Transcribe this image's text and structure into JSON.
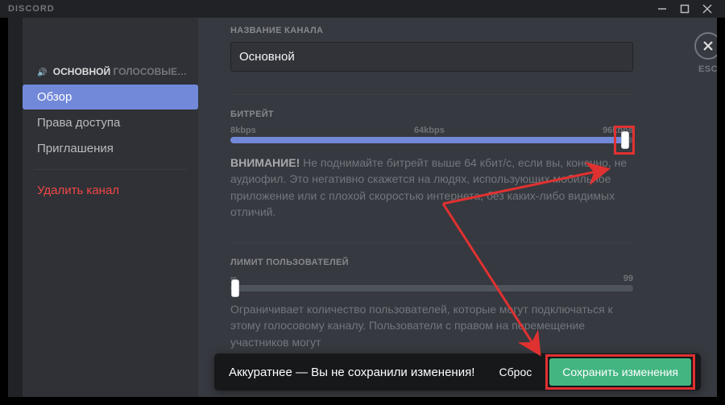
{
  "titlebar": {
    "wordmark": "DISCORD"
  },
  "close": {
    "esc": "ESC"
  },
  "sidebar": {
    "channel_name": "ОСНОВНОЙ",
    "category": "ГОЛОСОВЫЕ КАН…",
    "items": {
      "overview": "Обзор",
      "permissions": "Права доступа",
      "invites": "Приглашения",
      "delete": "Удалить канал"
    }
  },
  "sections": {
    "name_label": "НАЗВАНИЕ КАНАЛА",
    "name_value": "Основной",
    "bitrate_label": "БИТРЕЙТ",
    "bitrate_ticks": {
      "min": "8kbps",
      "mid": "64kbps",
      "max": "96kbps"
    },
    "bitrate_fill_pct": 98,
    "bitrate_warn_bold": "ВНИМАНИЕ!",
    "bitrate_warn_text": " Не поднимайте битрейт выше 64 кбит/с, если вы, конечно, не аудиофил. Это негативно скажется на людях, использующих мобильное приложение или с плохой скоростью интернета, без каких-либо видимых отличий.",
    "userlimit_label": "ЛИМИТ ПОЛЬЗОВАТЕЛЕЙ",
    "userlimit_ticks": {
      "min": "∞",
      "max": "99"
    },
    "userlimit_fill_pct": 0,
    "userlimit_desc": "Ограничивает количество пользователей, которые могут подключаться к этому голосовому каналу. Пользователи с правом на перемещение участников могут"
  },
  "unsaved": {
    "msg": "Аккуратнее — Вы не сохранили изменения!",
    "reset": "Сброс",
    "save": "Сохранить изменения"
  }
}
